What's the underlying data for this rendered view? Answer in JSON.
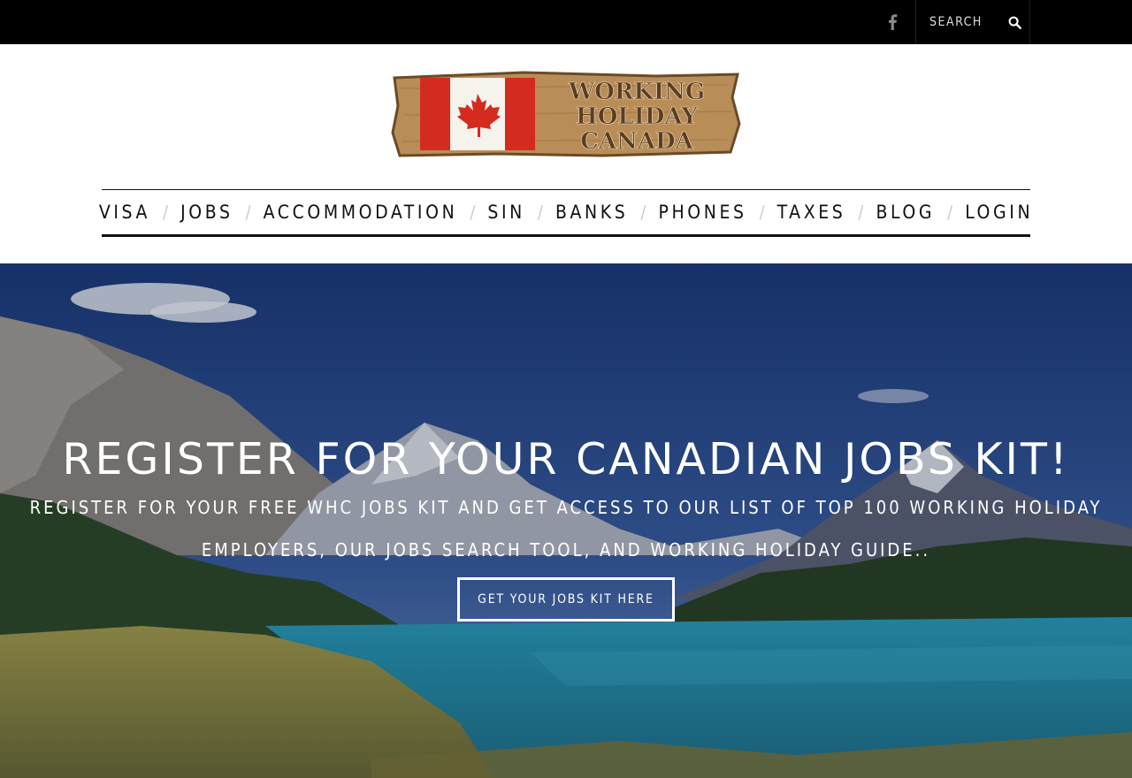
{
  "topbar": {
    "facebook_icon": "facebook-icon",
    "search_placeholder": "SEARCH",
    "search_icon": "search-icon"
  },
  "logo": {
    "line1": "WORKING",
    "line2": "HOLIDAY",
    "line3": "CANADA"
  },
  "nav": {
    "items": [
      {
        "label": "VISA"
      },
      {
        "label": "JOBS"
      },
      {
        "label": "ACCOMMODATION"
      },
      {
        "label": "SIN"
      },
      {
        "label": "BANKS"
      },
      {
        "label": "PHONES"
      },
      {
        "label": "TAXES"
      },
      {
        "label": "BLOG"
      },
      {
        "label": "LOGIN"
      }
    ],
    "separator": "/"
  },
  "hero": {
    "title": "REGISTER FOR YOUR CANADIAN JOBS KIT!",
    "subtitle": "REGISTER FOR YOUR FREE WHC JOBS KIT AND GET ACCESS TO OUR LIST OF TOP 100 WORKING HOLIDAY EMPLOYERS, OUR JOBS SEARCH TOOL, AND WORKING HOLIDAY GUIDE..",
    "button_label": "GET YOUR JOBS KIT HERE"
  },
  "colors": {
    "topbar_bg": "#000000",
    "flag_red": "#d52b1e",
    "wood": "#c9a26b",
    "lake": "#2f8fa8"
  }
}
